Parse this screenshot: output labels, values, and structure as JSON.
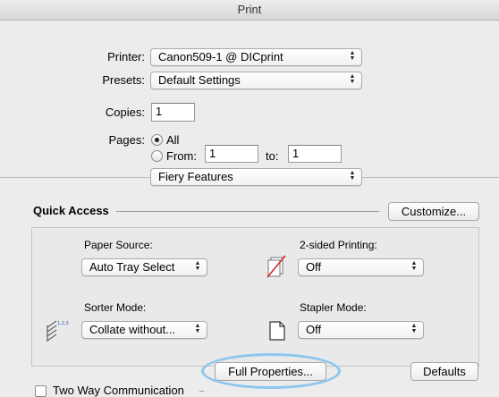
{
  "window": {
    "title": "Print"
  },
  "printer": {
    "label": "Printer:",
    "value": "Canon509-1 @ DICprint"
  },
  "presets": {
    "label": "Presets:",
    "value": "Default Settings"
  },
  "copies": {
    "label": "Copies:",
    "value": "1"
  },
  "pages": {
    "label": "Pages:",
    "all_label": "All",
    "from_label": "From:",
    "from_value": "1",
    "to_label": "to:",
    "to_value": "1",
    "selected": "All"
  },
  "section_popup": {
    "value": "Fiery Features"
  },
  "quick_access": {
    "title": "Quick Access",
    "customize_label": "Customize...",
    "paper_source": {
      "label": "Paper Source:",
      "value": "Auto Tray Select"
    },
    "two_sided": {
      "label": "2-sided Printing:",
      "value": "Off"
    },
    "sorter": {
      "label": "Sorter Mode:",
      "value": "Collate without..."
    },
    "stapler": {
      "label": "Stapler Mode:",
      "value": "Off"
    }
  },
  "buttons": {
    "full_properties": "Full Properties...",
    "defaults": "Defaults"
  },
  "two_way": {
    "label": "Two Way Communication"
  },
  "colors": {
    "highlight": "#8cc6ee",
    "background": "#ececec"
  },
  "icons": [
    "no-duplex-icon",
    "sorter-icon",
    "document-icon",
    "chevron-updown-icon"
  ]
}
